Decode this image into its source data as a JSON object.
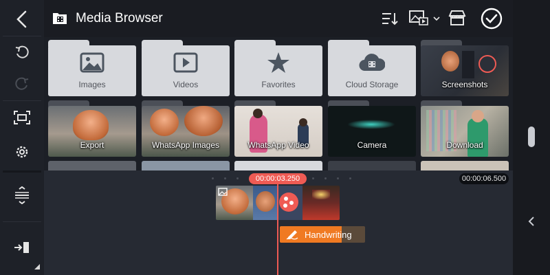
{
  "header": {
    "title": "Media Browser"
  },
  "folders": [
    {
      "label": "Images",
      "icon": "image-icon"
    },
    {
      "label": "Videos",
      "icon": "play-icon"
    },
    {
      "label": "Favorites",
      "icon": "star-icon"
    },
    {
      "label": "Cloud Storage",
      "icon": "cloud-icon"
    },
    {
      "label": "Screenshots"
    },
    {
      "label": "Export"
    },
    {
      "label": "WhatsApp Images"
    },
    {
      "label": "WhatsApp Video"
    },
    {
      "label": "Camera"
    },
    {
      "label": "Download"
    }
  ],
  "timeline": {
    "playhead_time": "00:00:03.250",
    "total_time": "00:00:06.500",
    "layer_label": "Handwriting"
  },
  "colors": {
    "accent_red": "#ef5b54",
    "layer_orange": "#f07a22",
    "panel": "#1e2128"
  }
}
